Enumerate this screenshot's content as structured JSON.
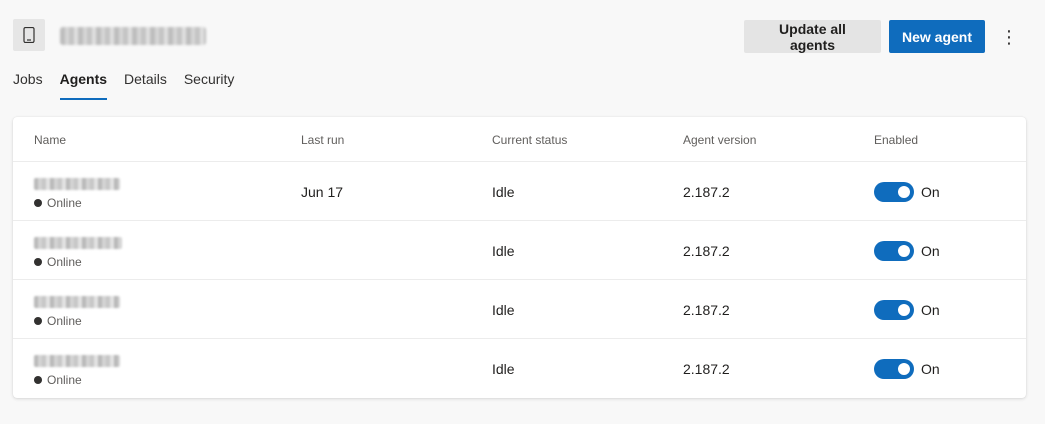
{
  "header": {
    "pool_icon": "mobile-device-icon",
    "pool_name": "████████████████",
    "update_button": "Update all agents",
    "new_button": "New agent",
    "more_icon": "⋮"
  },
  "tabs": [
    {
      "label": "Jobs",
      "active": false
    },
    {
      "label": "Agents",
      "active": true
    },
    {
      "label": "Details",
      "active": false
    },
    {
      "label": "Security",
      "active": false
    }
  ],
  "table": {
    "columns": [
      "Name",
      "Last run",
      "Current status",
      "Agent version",
      "Enabled"
    ],
    "rows": [
      {
        "name": "████████████",
        "status": "Online",
        "last_run": "Jun 17",
        "current_status": "Idle",
        "version": "2.187.2",
        "enabled_label": "On"
      },
      {
        "name": "████████████",
        "status": "Online",
        "last_run": "",
        "current_status": "Idle",
        "version": "2.187.2",
        "enabled_label": "On"
      },
      {
        "name": "████████████",
        "status": "Online",
        "last_run": "",
        "current_status": "Idle",
        "version": "2.187.2",
        "enabled_label": "On"
      },
      {
        "name": "████████████",
        "status": "Online",
        "last_run": "",
        "current_status": "Idle",
        "version": "2.187.2",
        "enabled_label": "On"
      }
    ]
  },
  "colors": {
    "accent": "#0f6cbd",
    "background": "#f8f8f8",
    "card": "#ffffff"
  }
}
